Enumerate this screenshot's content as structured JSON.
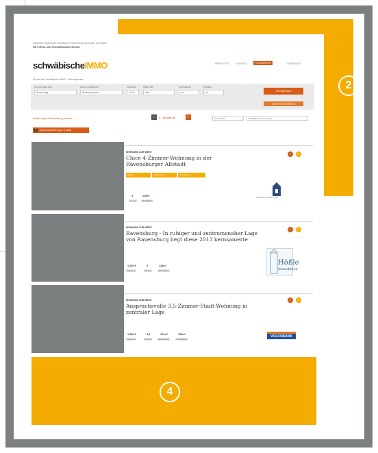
{
  "header": {
    "tagline": "Immobilien, Wohnungen und Häuser in Ravensburg zum Kaufen und Mieten",
    "subtagline": "EIN PORTAL DER SCHWÄBISCHEN ZEITUNG",
    "logo_part1": "schwäbische",
    "logo_part2": "IMMO",
    "nav": [
      "MERKLISTE",
      "KONTAKT"
    ],
    "nav_primary": "ANZEIGEN",
    "nav_login": "ANMELDEN"
  },
  "breadcrumb": "Sie sind hier: schwäbische IMMO > Suchergebnisse",
  "search": {
    "fields": [
      {
        "label": "WO SUCHEN SIE?",
        "value": "Ravensburg"
      },
      {
        "label": "WAS SUCHEN SIE?",
        "value": "Wohnung mieten"
      },
      {
        "label": "UMKREIS",
        "value": "10 km"
      },
      {
        "label": "PREIS BIS",
        "value": "max."
      },
      {
        "label": "GRÖSSE AB",
        "value": "qm"
      },
      {
        "label": "ZIMMER",
        "value": "ab"
      }
    ],
    "submit": "38 Ergebnisse",
    "more": "WEITERE KRITERIEN"
  },
  "results": {
    "heading": "Wohnung in Ravensburg mieten",
    "save_search": "Suche speichern (per E-Mail)",
    "pagination": "1 - 10 von 38",
    "sort_placeholder": "10 pro Seite",
    "sort_by": "aktualität (neueste zuerst)"
  },
  "listings": [
    {
      "type": "WOHNUNG ZUR MIETE",
      "title": "Chice 4-Zimmer-Wohnung in der Ravensburger Altstadt",
      "tags": [
        "Balkon",
        "Gartenanteil",
        "Einbauküche"
      ],
      "stats": [
        {
          "value": "4",
          "label": "Zimmer"
        },
        {
          "value": "110m²",
          "label": "Wohnfläche"
        }
      ],
      "logo_text": "Immobilien GmbH & Co. KG"
    },
    {
      "type": "WOHNUNG ZUR MIETE",
      "title": "Ravensburg - In ruhiger und zentrumsnaher Lage von Ravensburg liegt diese 2013 kernsanierte",
      "tags": [],
      "stats": [
        {
          "value": "1.230 €",
          "label": "Kaltmiete"
        },
        {
          "value": "4",
          "label": "Zimmer"
        },
        {
          "value": "124m²",
          "label": "Wohnfläche"
        }
      ],
      "logo_text": "Hößle",
      "logo_sub": "Immobilien"
    },
    {
      "type": "WOHNUNG ZUR MIETE",
      "title": "Ansprachsvolle 3,5-Zimmer-Stadt-Wohnung in zentraler Lage",
      "tags": [],
      "stats": [
        {
          "value": "1.280 €",
          "label": "Kaltmiete"
        },
        {
          "value": "3,5",
          "label": "Zimmer"
        },
        {
          "value": "124m²",
          "label": "Wohnfläche"
        },
        {
          "value": "130m²",
          "label": "Grundfläche"
        }
      ],
      "logo_text": "VOLKSBANK"
    }
  ],
  "callouts": {
    "badge_2": "2",
    "badge_4": "4"
  },
  "colors": {
    "frame": "#7b7f80",
    "highlight": "#f4ac00",
    "accent": "#d65b17",
    "placeholder": "#7b7f80"
  }
}
